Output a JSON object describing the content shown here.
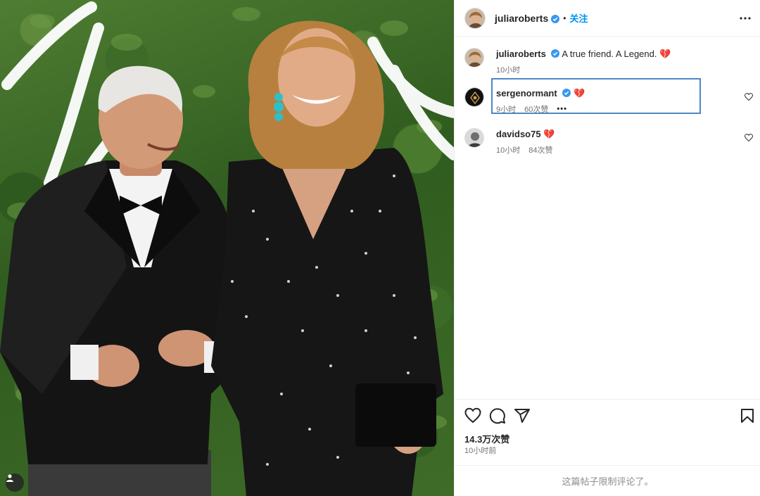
{
  "post": {
    "image_alt": "photo",
    "author": {
      "username": "juliaroberts",
      "verified": true,
      "follow_label": "关注",
      "separator": "•"
    }
  },
  "caption": {
    "username": "juliaroberts",
    "text": "A true friend. A Legend.",
    "emoji": "💔",
    "time": "10小时"
  },
  "comments": [
    {
      "username": "sergenormant",
      "verified": true,
      "text": "",
      "emoji": "💔",
      "time": "9小时",
      "likes": "60次赞",
      "more": "•••"
    },
    {
      "username": "davidso75",
      "verified": false,
      "text": "",
      "emoji": "💔",
      "time": "10小时",
      "likes": "84次赞"
    }
  ],
  "actions": {
    "likes_label": "14.3万次赞",
    "time_ago": "10小时前",
    "icons": [
      "heart-icon",
      "comment-icon",
      "share-icon",
      "bookmark-icon"
    ]
  },
  "footer": {
    "notice": "这篇帖子限制评论了。"
  },
  "colors": {
    "accent": "#0095f6",
    "verified": "#3897f0",
    "highlight": "#4a8ac4",
    "muted": "#737373"
  }
}
